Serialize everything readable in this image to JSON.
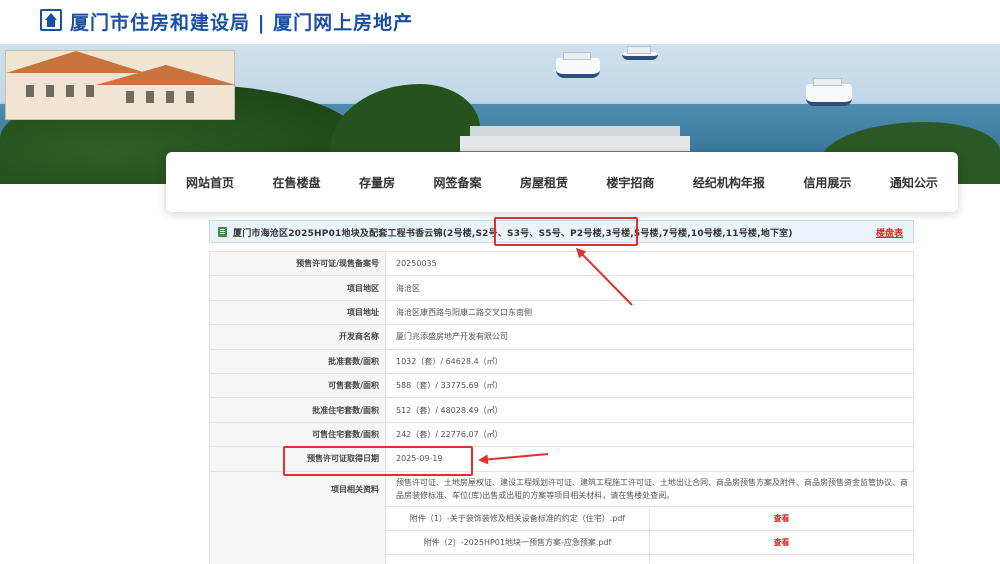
{
  "header": {
    "title": "厦门市住房和建设局 | 厦门网上房地产"
  },
  "nav": {
    "items": [
      "网站首页",
      "在售楼盘",
      "存量房",
      "网签备案",
      "房屋租赁",
      "楼宇招商",
      "经纪机构年报",
      "信用展示",
      "通知公示"
    ]
  },
  "project": {
    "title": "厦门市海沧区2025HP01地块及配套工程书香云锦(2号楼,S2号、S3号、S5号、P2号楼,3号楼,5号楼,7号楼,10号楼,11号楼,地下室)",
    "link_label": "楼盘表"
  },
  "details": [
    {
      "label": "预售许可证/现售备案号",
      "value": "20250035"
    },
    {
      "label": "项目地区",
      "value": "海沧区"
    },
    {
      "label": "项目地址",
      "value": "海沧区康西路与阳康二路交叉口东南侧"
    },
    {
      "label": "开发商名称",
      "value": "厦门兆添盛房地产开发有限公司"
    },
    {
      "label": "批准套数/面积",
      "value": "1032（套）/ 64628.4（㎡）"
    },
    {
      "label": "可售套数/面积",
      "value": "588（套）/ 33775.69（㎡）"
    },
    {
      "label": "批准住宅套数/面积",
      "value": "512（套）/ 48028.49（㎡）"
    },
    {
      "label": "可售住宅套数/面积",
      "value": "242（套）/ 22776.07（㎡）"
    },
    {
      "label": "预售许可证取得日期",
      "value": "2025-09-19"
    }
  ],
  "materials": {
    "label": "项目相关资料",
    "description": "预售许可证、土地房屋权证、建设工程规划许可证、建筑工程施工许可证、土地出让合同、商品房预售方案及附件、商品房预售资金监管协议、商品房装修标准、车位(库)出售或出租的方案等项目相关材料，请在售楼处查阅。",
    "attachments": [
      {
        "name": "附件（1）-关于装饰装修及相关设备标准的约定（住宅）.pdf",
        "action": "查看"
      },
      {
        "name": "附件（2）-2025HP01地块一预售方案-应急预案.pdf",
        "action": "查看"
      }
    ]
  },
  "colors": {
    "brand": "#1a4fa3",
    "link_red": "#d62a2a",
    "annotation": "#e0302a"
  }
}
